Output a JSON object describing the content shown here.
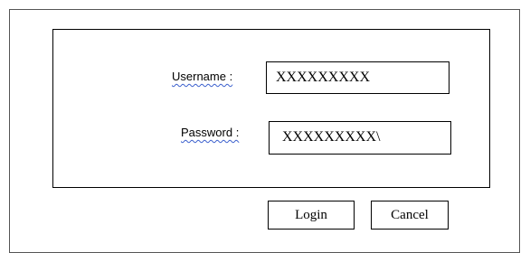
{
  "login_form": {
    "username_label": "Username :",
    "username_value": "XXXXXXXXX",
    "password_label": "Password :",
    "password_value": "XXXXXXXXX\\",
    "login_label": "Login",
    "cancel_label": "Cancel"
  }
}
